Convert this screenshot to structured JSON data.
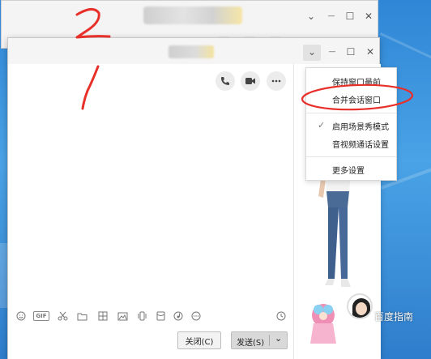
{
  "back_window": {
    "controls": {
      "dropdown": "⌄",
      "minimize": "—",
      "maximize": "☐",
      "close": "✕"
    }
  },
  "front_window": {
    "controls": {
      "dropdown": "⌄",
      "minimize": "—",
      "maximize": "☐",
      "close": "✕"
    },
    "header_icons": [
      "phone-icon",
      "video-camera-icon",
      "more-icon"
    ],
    "toolbar_icons": [
      "emoji-icon",
      "gif-icon",
      "scissors-icon",
      "folder-icon",
      "image-collection-icon",
      "image-icon",
      "shake-icon",
      "red-packet-icon",
      "music-icon",
      "more-tools-icon"
    ],
    "gif_label": "GIF",
    "history_icon": "clock-icon",
    "buttons": {
      "close_label": "关闭(C)",
      "send_label": "发送(S)",
      "send_arrow": "⌄"
    }
  },
  "menu": {
    "items": [
      {
        "label": "保持窗口最前",
        "checked": false
      },
      {
        "label": "合并会话窗口",
        "checked": false
      },
      {
        "label": "启用场景秀模式",
        "checked": true
      },
      {
        "label": "音视频通话设置",
        "checked": false
      },
      {
        "label": "更多设置",
        "checked": false
      }
    ],
    "check_mark": "✓"
  },
  "annotations": {
    "number_2": "2",
    "number_1": "1",
    "color": "#e8302a"
  },
  "watermark": {
    "text": "百度指南"
  },
  "colors": {
    "desktop": "#3a8fdc",
    "window_bg": "#ffffff",
    "annotation_red": "#e8302a"
  }
}
